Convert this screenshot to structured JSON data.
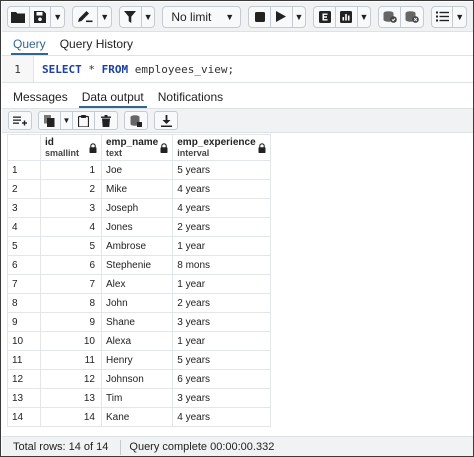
{
  "toolbar": {
    "limit_value": "No limit",
    "icons": [
      "folder-icon",
      "save-icon",
      "chevron-down-icon",
      "pen-icon",
      "chevron-down-icon",
      "filter-icon",
      "chevron-down-icon",
      "stop-icon",
      "play-icon",
      "chevron-down-icon",
      "explain-icon",
      "explain-analyze-icon",
      "chevron-down-icon",
      "commit-icon",
      "rollback-icon",
      "format-list-icon",
      "chevron-down-icon"
    ]
  },
  "query_tabs": [
    {
      "label": "Query",
      "active": true
    },
    {
      "label": "Query History",
      "active": false
    }
  ],
  "editor": {
    "line_number": "1",
    "code": {
      "select": "SELECT",
      "star": " * ",
      "from": "FROM",
      "rest": " employees_view;"
    }
  },
  "output_tabs": [
    {
      "label": "Messages",
      "active": false
    },
    {
      "label": "Data output",
      "active": true
    },
    {
      "label": "Notifications",
      "active": false
    }
  ],
  "grid": {
    "columns": [
      {
        "name": "id",
        "type": "smallint"
      },
      {
        "name": "emp_name",
        "type": "text"
      },
      {
        "name": "emp_experience",
        "type": "interval"
      }
    ],
    "rows": [
      {
        "rn": "1",
        "id": "1",
        "name": "Joe",
        "exp": "5 years"
      },
      {
        "rn": "2",
        "id": "2",
        "name": "Mike",
        "exp": "4 years"
      },
      {
        "rn": "3",
        "id": "3",
        "name": "Joseph",
        "exp": "4 years"
      },
      {
        "rn": "4",
        "id": "4",
        "name": "Jones",
        "exp": "2 years"
      },
      {
        "rn": "5",
        "id": "5",
        "name": "Ambrose",
        "exp": "1 year"
      },
      {
        "rn": "6",
        "id": "6",
        "name": "Stephenie",
        "exp": "8 mons"
      },
      {
        "rn": "7",
        "id": "7",
        "name": "Alex",
        "exp": "1 year"
      },
      {
        "rn": "8",
        "id": "8",
        "name": "John",
        "exp": "2 years"
      },
      {
        "rn": "9",
        "id": "9",
        "name": "Shane",
        "exp": "3 years"
      },
      {
        "rn": "10",
        "id": "10",
        "name": "Alexa",
        "exp": "1 year"
      },
      {
        "rn": "11",
        "id": "11",
        "name": "Henry",
        "exp": "5 years"
      },
      {
        "rn": "12",
        "id": "12",
        "name": "Johnson",
        "exp": "6 years"
      },
      {
        "rn": "13",
        "id": "13",
        "name": "Tim",
        "exp": "3 years"
      },
      {
        "rn": "14",
        "id": "14",
        "name": "Kane",
        "exp": "4 years"
      }
    ]
  },
  "status": {
    "total_rows": "Total rows: 14 of 14",
    "query_complete": "Query complete 00:00:00.332"
  },
  "colors": {
    "accent": "#326690",
    "keyword": "#1b3fa6"
  }
}
